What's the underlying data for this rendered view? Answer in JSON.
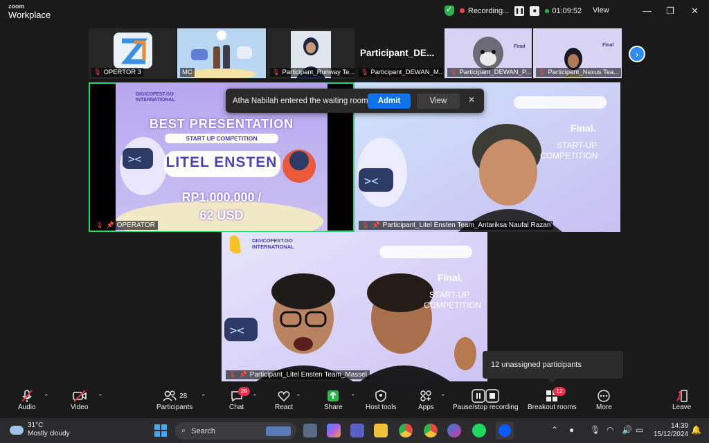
{
  "titlebar": {
    "brand_line1": "zoom",
    "brand_line2": "Workplace",
    "recording_label": "Recording...",
    "timer": "01:09:52",
    "view_label": "View"
  },
  "strip": {
    "thumbnails": [
      {
        "name": "OPERTOR 3"
      },
      {
        "name": "MC"
      },
      {
        "name": "Participant_Runway Te..."
      },
      {
        "name": "Participant_DEWAN_M..."
      },
      {
        "name": "Participant_DEWAN_P..."
      },
      {
        "name": "Participant_Nexus Tea..."
      }
    ],
    "big_name": "Participant_DE..."
  },
  "tiles": {
    "operator": {
      "name": "OPERATOR",
      "slide_brand": "DIGICOFEST.GO INTERNATIONAL",
      "slide_title": "BEST PRESENTATION",
      "slide_subtitle": "START UP COMPETITION",
      "slide_team": "LITEL ENSTEN",
      "slide_prize_1": "RP1.000.000 /",
      "slide_prize_2": "62 USD"
    },
    "antariksa": {
      "name": "Participant_Litel Ensten Team_Antariksa Naufal Razan",
      "bg_final": "Final.",
      "bg_startup": "START-UP",
      "bg_competition": "COMPETITION"
    },
    "massel": {
      "name": "Participant_Litel Ensten Team_Massel",
      "bg_brand": "DIGICOFEST.GO INTERNATIONAL",
      "bg_final": "Final.",
      "bg_startup": "START-UP",
      "bg_competition": "COMPETITION"
    }
  },
  "waiting_room": {
    "message": "Atha Nabilah entered the waiting room",
    "admit_label": "Admit",
    "view_label": "View"
  },
  "tooltip": "12 unassigned participants",
  "toolbar": {
    "audio": "Audio",
    "video": "Video",
    "participants": "Participants",
    "participants_count": "28",
    "chat": "Chat",
    "chat_badge": "29",
    "react": "React",
    "share": "Share",
    "host_tools": "Host tools",
    "apps": "Apps",
    "record": "Pause/stop recording",
    "breakout": "Breakout rooms",
    "breakout_badge": "12",
    "more": "More",
    "leave": "Leave"
  },
  "taskbar": {
    "temp": "31°C",
    "weather": "Mostly cloudy",
    "search": "Search",
    "time": "14:39",
    "date": "15/12/2024"
  },
  "colors": {
    "accent": "#0e72ed",
    "active_speaker": "#23d86c",
    "badge": "#e8304a"
  }
}
